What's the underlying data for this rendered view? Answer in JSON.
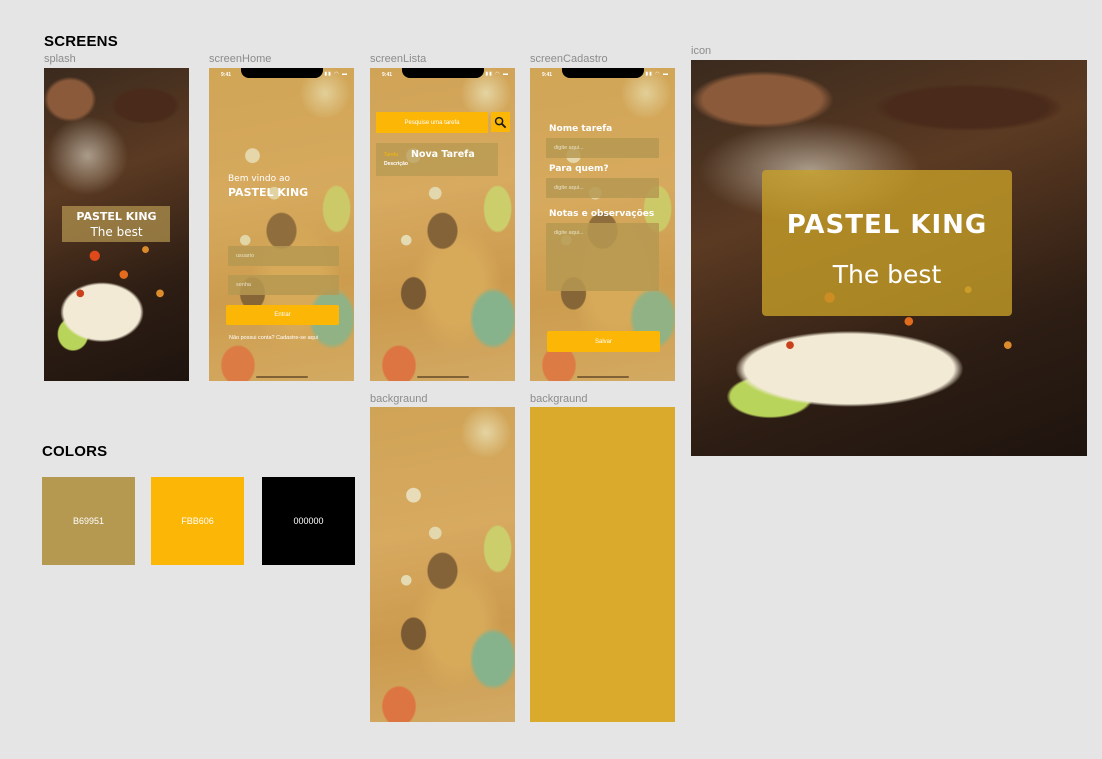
{
  "headings": {
    "screens": "SCREENS",
    "colors": "COLORS"
  },
  "frames": {
    "splash": "splash",
    "home": "screenHome",
    "lista": "screenLista",
    "cadastro": "screenCadastro",
    "icon": "icon",
    "background1": "backgraund",
    "background2": "backgraund"
  },
  "status": {
    "time": "9:41",
    "icons": "▮▮ ◠ ▬"
  },
  "splash": {
    "title": "PASTEL KING",
    "subtitle": "The best"
  },
  "home": {
    "welcome_line1": "Bem vindo ao",
    "welcome_line2": "PASTEL KING",
    "user_placeholder": "usuario",
    "password_placeholder": "senha",
    "enter_button": "Entrar",
    "signup_text": "Não possui conta? Cadastre-se aqui"
  },
  "lista": {
    "search_placeholder": "Pesquise uma tarefa",
    "search_icon": "search-icon",
    "task_prefix": "Tarefa",
    "task_title": "Nova Tarefa",
    "task_desc": "Descrição"
  },
  "cadastro": {
    "name_label": "Nome tarefa",
    "name_placeholder": "digite aqui...",
    "for_label": "Para quem?",
    "for_placeholder": "digite aqui...",
    "notes_label": "Notas e observações",
    "notes_placeholder": "digite aqui...",
    "save_button": "Salvar"
  },
  "icon": {
    "title": "PASTEL KING",
    "subtitle": "The best"
  },
  "colors": [
    {
      "hex": "#B69951",
      "label": "B69951",
      "text_color": "#ffffff"
    },
    {
      "hex": "#FBB606",
      "label": "FBB606",
      "text_color": "#ffffff"
    },
    {
      "hex": "#000000",
      "label": "000000",
      "text_color": "#ffffff"
    }
  ],
  "background2_color": "#D9AA2B"
}
